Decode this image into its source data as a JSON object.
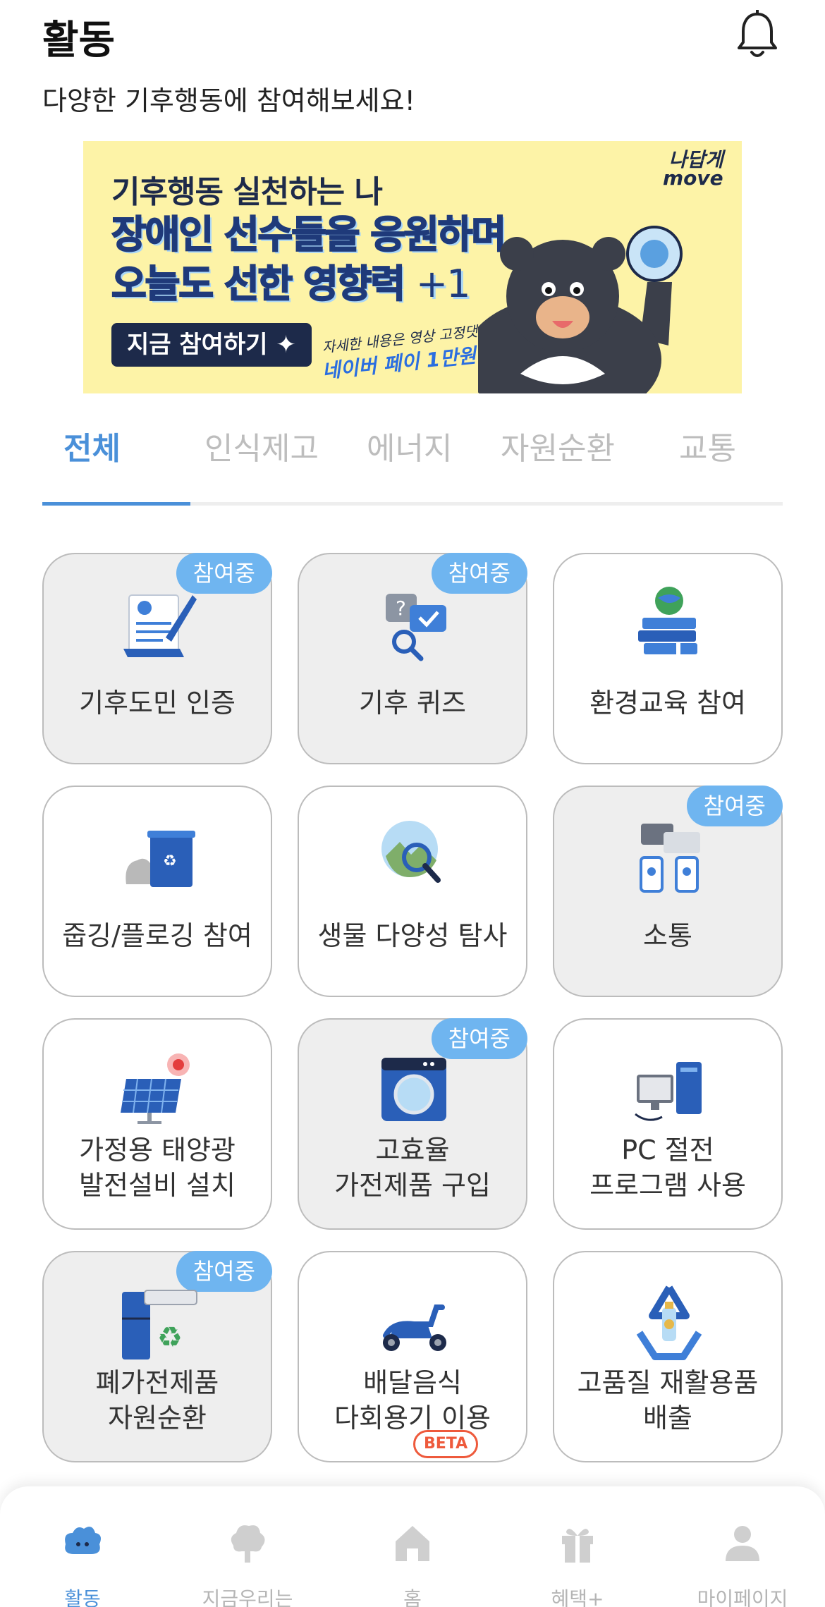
{
  "header": {
    "title": "활동",
    "subtitle": "다양한 기후행동에 참여해보세요!"
  },
  "banner": {
    "line1": "기후행동 실천하는 나",
    "line2": "장애인 선수들을 응원하며",
    "line3": "오늘도 선한 영향력",
    "line3_suffix": "+1",
    "cta": "지금 참여하기",
    "note1": "자세한 내용은 영상 고정댓글 확인",
    "note2": "네이버 페이 1만원 쏜다!",
    "brand_top": "나답게",
    "brand_bottom": "move"
  },
  "tabs": [
    {
      "label": "전체",
      "active": true
    },
    {
      "label": "인식제고",
      "active": false
    },
    {
      "label": "에너지",
      "active": false
    },
    {
      "label": "자원순환",
      "active": false
    },
    {
      "label": "교통",
      "active": false
    }
  ],
  "badge_label": "참여중",
  "cards": [
    {
      "label": "기후도민 인증",
      "joined": true,
      "icon": "certificate-icon"
    },
    {
      "label": "기후 퀴즈",
      "joined": true,
      "icon": "quiz-icon"
    },
    {
      "label": "환경교육 참여",
      "joined": false,
      "icon": "books-globe-icon"
    },
    {
      "label": "줍깅/플로깅 참여",
      "joined": false,
      "icon": "recycle-bin-icon"
    },
    {
      "label": "생물 다양성 탐사",
      "joined": false,
      "icon": "magnifier-globe-icon"
    },
    {
      "label": "소통",
      "joined": true,
      "icon": "chat-phones-icon"
    },
    {
      "label": "가정용 태양광\n발전설비 설치",
      "joined": false,
      "icon": "solar-panel-icon"
    },
    {
      "label": "고효율\n가전제품 구입",
      "joined": true,
      "icon": "washing-machine-icon"
    },
    {
      "label": "PC 절전\n프로그램 사용",
      "joined": false,
      "icon": "pc-icon"
    },
    {
      "label": "폐가전제품\n자원순환",
      "joined": true,
      "icon": "appliance-recycle-icon"
    },
    {
      "label": "배달음식\n다회용기 이용",
      "joined": false,
      "icon": "scooter-icon"
    },
    {
      "label": "고품질 재활용품\n배출",
      "joined": false,
      "icon": "recycle-bottle-icon"
    }
  ],
  "bottom_nav": [
    {
      "label": "활동",
      "icon": "activity-icon",
      "active": true
    },
    {
      "label": "지금우리는",
      "icon": "tree-icon",
      "active": false
    },
    {
      "label": "홈",
      "icon": "home-icon",
      "active": false
    },
    {
      "label": "혜택+",
      "icon": "gift-icon",
      "active": false
    },
    {
      "label": "마이페이지",
      "icon": "person-icon",
      "active": false
    }
  ],
  "beta_label": "BETA",
  "colors": {
    "accent": "#4a90d9",
    "badge": "#6fb5f0",
    "banner_bg": "#fdf3a7",
    "beta": "#ee5a3c"
  }
}
